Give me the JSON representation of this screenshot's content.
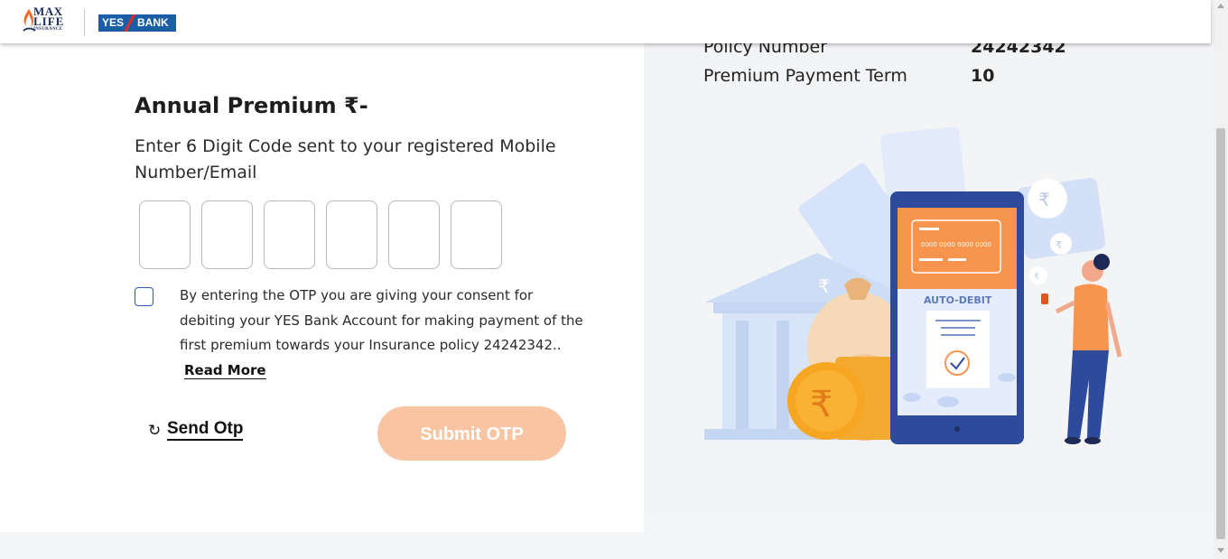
{
  "header": {
    "maxlife_logo": {
      "line1": "MAX",
      "line2": "LIFE",
      "line3": "INSURANCE"
    },
    "yes_bank_logo": {
      "part1": "YES",
      "part2": "BANK"
    }
  },
  "policy_details": [
    {
      "label": "Policy Number",
      "value": "24242342"
    },
    {
      "label": "Premium Payment Term",
      "value": "10"
    }
  ],
  "form": {
    "annual_premium": "Annual Premium ₹-",
    "otp_instruction": "Enter 6 Digit Code sent to your registered Mobile Number/Email",
    "otp_digits": [
      "",
      "",
      "",
      "",
      "",
      ""
    ],
    "consent_text": "By entering the OTP you are giving your consent for debiting your YES Bank Account for making payment of the first premium towards your Insurance policy 24242342..",
    "consent_checked": false,
    "read_more": "Read More",
    "send_otp": "Send Otp",
    "submit_otp": "Submit OTP"
  },
  "illustration": {
    "card_number": "0000 0000 0000 0000",
    "auto_debit_label": "AUTO-DEBIT",
    "rupee_symbol": "₹"
  },
  "colors": {
    "accent_orange": "#f7944d",
    "submit_disabled": "#f8c4a2",
    "checkbox_border": "#2a5ca8",
    "phone_blue": "#2e4b9b",
    "illustration_light_blue": "#dbe6fb"
  }
}
